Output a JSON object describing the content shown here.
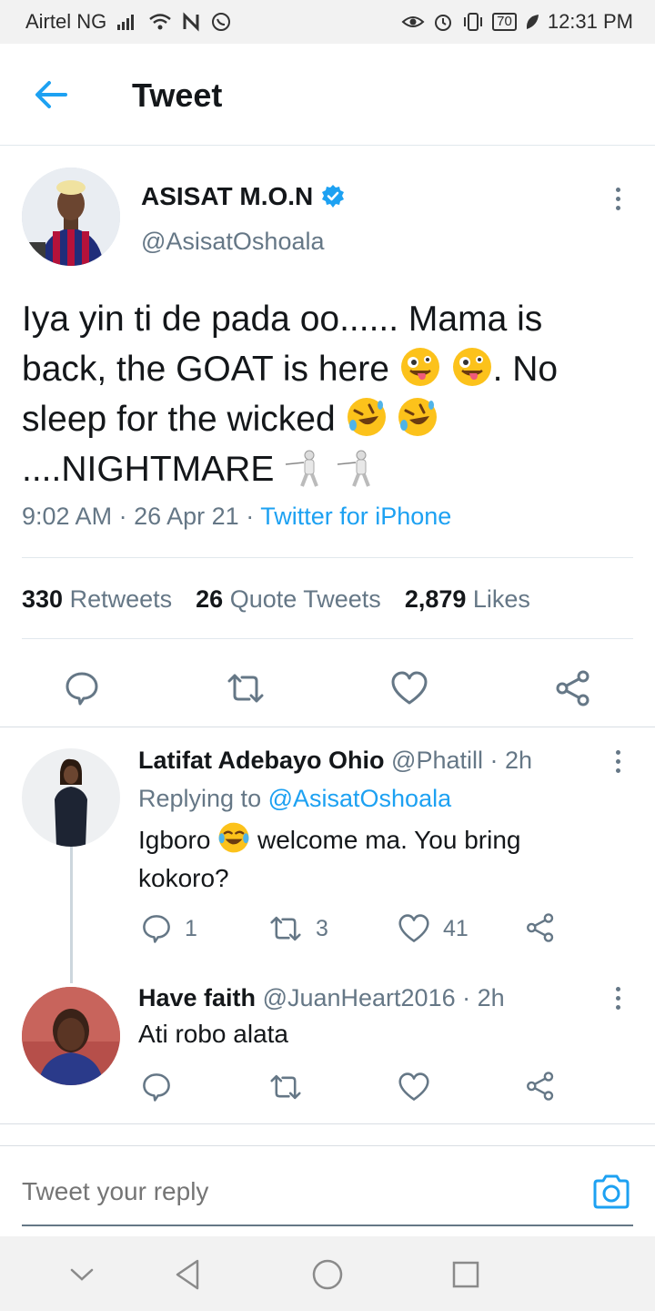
{
  "status_bar": {
    "carrier": "Airtel NG",
    "battery": "70",
    "time": "12:31 PM"
  },
  "header": {
    "title": "Tweet"
  },
  "tweet": {
    "author_name": "ASISAT M.O.N",
    "handle": "@AsisatOshoala",
    "text_part1": "Iya yin ti de pada oo...... Mama is back, the GOAT is here",
    "text_part2": ". No sleep for the wicked",
    "text_part3": "....NIGHTMARE",
    "time": "9:02 AM",
    "date": "26 Apr 21",
    "source": "Twitter for iPhone",
    "retweets_count": "330",
    "retweets_label": "Retweets",
    "quotes_count": "26",
    "quotes_label": "Quote Tweets",
    "likes_count": "2,879",
    "likes_label": "Likes"
  },
  "replies": [
    {
      "name": "Latifat Adebayo Ohio",
      "handle": "@Phatill",
      "age": "2h",
      "replying_prefix": "Replying to",
      "replying_to": "@AsisatOshoala",
      "text_part1": "Igboro",
      "text_part2": "welcome ma. You bring kokoro?",
      "reply_count": "1",
      "retweet_count": "3",
      "like_count": "41"
    },
    {
      "name": "Have faith",
      "handle": "@JuanHeart2016",
      "age": "2h",
      "text": "Ati robo alata"
    }
  ],
  "composer": {
    "placeholder": "Tweet your reply"
  },
  "colors": {
    "accent": "#1da1f2",
    "secondary_text": "#657786",
    "primary_text": "#14171a"
  }
}
